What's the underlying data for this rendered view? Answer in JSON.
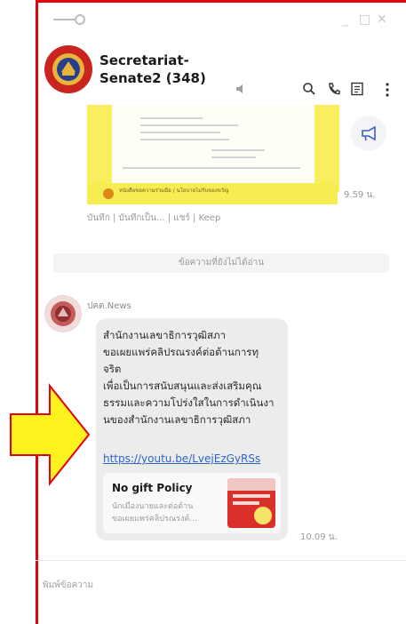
{
  "window": {
    "minimize_glyph": "_",
    "maximize_glyph": "□",
    "close_glyph": "✕"
  },
  "header": {
    "title_line1": "Secretariat-",
    "title_line2": "Senate2 (348)"
  },
  "shared_post": {
    "banner_text": "หนังสือขอความร่วมมือ / นโยบายไม่รับของขวัญ",
    "time": "9.59 น.",
    "footer": "บันทึก | บันทึกเป็น... | แชร์ | Keep"
  },
  "divider": {
    "label": "ข้อความที่ยังไม่ได้อ่าน"
  },
  "message": {
    "sender": "ปคต.News",
    "lines": [
      "สำนักงานเลขาธิการวุฒิสภา",
      "ขอเผยแพร่คลิปรณรงค์ต่อต้านการทุ",
      "จริต",
      "เพื่อเป็นการสนับสนุนและส่งเสริมคุณ",
      "ธรรมและความโปร่งใสในการดำเนินงา",
      "นของสำนักงานเลขาธิการวุฒิสภา"
    ],
    "link": "https://youtu.be/LvejEzGyRSs",
    "card_title": "No gift Policy",
    "card_sub1": "นักเมืองนายและต่อต้าน",
    "card_sub2": "ขอเผยแพร่คลิปรณรงค์...",
    "time": "10.09 น."
  },
  "input": {
    "placeholder": "พิมพ์ข้อความ"
  },
  "colors": {
    "annotation_red": "#e4000f",
    "arrow_yellow": "#fdf21e",
    "link": "#2b64c8"
  }
}
